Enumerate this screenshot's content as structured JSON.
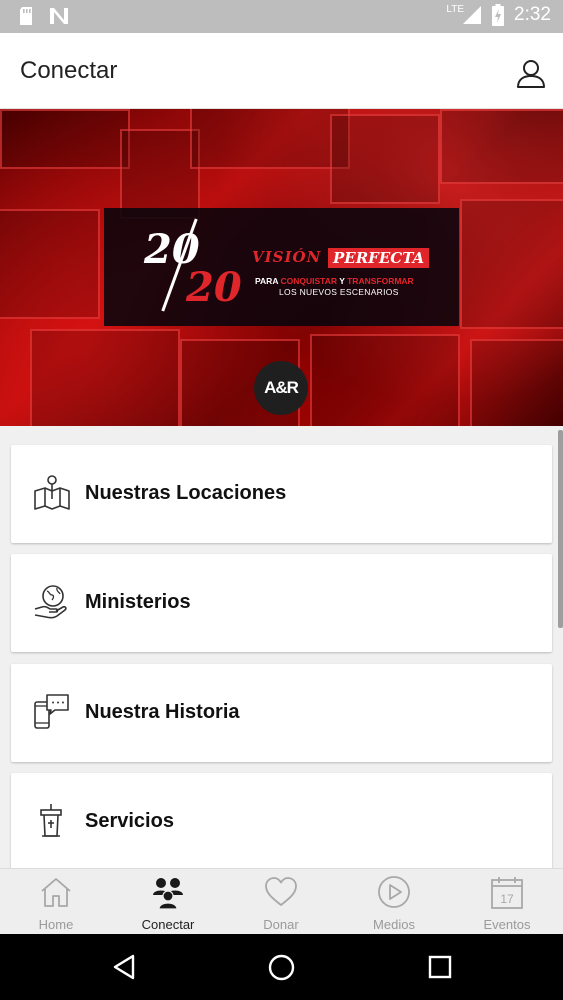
{
  "status_bar": {
    "time": "2:32",
    "network": "LTE"
  },
  "app_bar": {
    "title": "Conectar"
  },
  "banner": {
    "number_top": "20",
    "number_bottom": "20",
    "vision": "VISIÓN",
    "perfecta": "PERFECTA",
    "line1_a": "PARA ",
    "line1_b": "CONQUISTAR",
    "line1_c": " Y ",
    "line1_d": "TRANSFORMAR",
    "line2": "LOS NUEVOS ESCENARIOS",
    "logo_text": "A&R"
  },
  "menu": [
    {
      "label": "Nuestras Locaciones",
      "icon": "map-pin-icon"
    },
    {
      "label": "Ministerios",
      "icon": "hand-globe-icon"
    },
    {
      "label": "Nuestra Historia",
      "icon": "phone-chat-icon"
    },
    {
      "label": "Servicios",
      "icon": "pulpit-icon"
    }
  ],
  "bottom_nav": [
    {
      "label": "Home",
      "icon": "home-icon",
      "active": false
    },
    {
      "label": "Conectar",
      "icon": "people-icon",
      "active": true
    },
    {
      "label": "Donar",
      "icon": "heart-icon",
      "active": false
    },
    {
      "label": "Medios",
      "icon": "play-icon",
      "active": false
    },
    {
      "label": "Eventos",
      "icon": "calendar-icon",
      "active": false,
      "day": "17"
    }
  ],
  "colors": {
    "accent_red": "#e0262b",
    "active_nav": "#222222",
    "inactive_nav": "#9a9a9a"
  }
}
